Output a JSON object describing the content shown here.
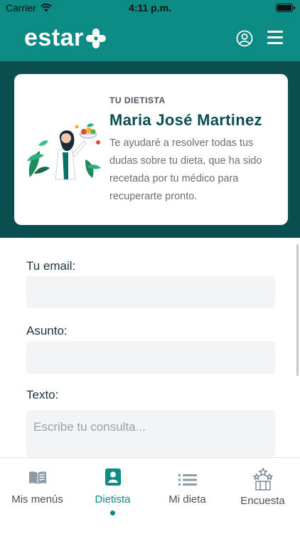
{
  "status_bar": {
    "carrier": "Carrier",
    "time": "4:11 p.m."
  },
  "header": {
    "logo_text": "estar",
    "logo_icon": "plus-cross-icon",
    "user_icon": "user-circle-icon",
    "menu_icon": "hamburger-menu-icon"
  },
  "dietitian_card": {
    "label": "TU DIETISTA",
    "name": "Maria José Martinez",
    "description": "Te ayudaré a resolver todas tus dudas sobre tu dieta, que ha sido recetada por tu médico para recuperarte pronto."
  },
  "form": {
    "email_label": "Tu email:",
    "email_value": "",
    "subject_label": "Asunto:",
    "subject_value": "",
    "text_label": "Texto:",
    "text_placeholder": "Escribe tu consulta..."
  },
  "tab_bar": {
    "active_tab": "Dietista",
    "tabs": [
      {
        "label": "Mis menús",
        "icon": "open-book-icon"
      },
      {
        "label": "Dietista",
        "icon": "person-badge-icon"
      },
      {
        "label": "Mi dieta",
        "icon": "list-icon"
      },
      {
        "label": "Encuesta",
        "icon": "stars-podium-icon"
      }
    ]
  },
  "colors": {
    "primary": "#0c8a84",
    "dark_band": "#0b4e52",
    "field_bg": "#f2f4f6"
  }
}
